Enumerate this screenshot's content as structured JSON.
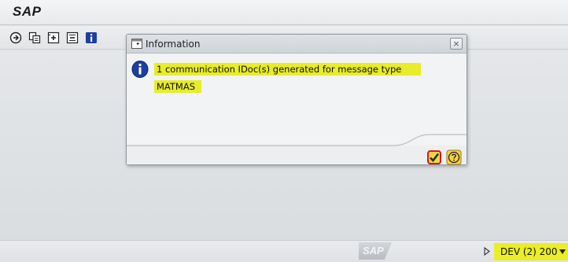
{
  "app": {
    "title": "SAP"
  },
  "toolbar": {
    "buttons": [
      {
        "icon": "execute-icon"
      },
      {
        "icon": "copy-icon"
      },
      {
        "icon": "expand-icon"
      },
      {
        "icon": "collapse-icon"
      },
      {
        "icon": "info-icon"
      }
    ]
  },
  "dialog": {
    "title": "Information",
    "close_label": "×",
    "message_line1": "1 communication IDoc(s) generated for message type",
    "message_line2": "MATMAS",
    "ok_icon": "checkmark-icon",
    "help_icon": "help-icon"
  },
  "statusbar": {
    "logo": "SAP",
    "system": "DEV (2) 200"
  },
  "colors": {
    "highlight": "#e8ec29",
    "ok_border": "#d21a1a",
    "info_blue": "#1c3fa0"
  }
}
